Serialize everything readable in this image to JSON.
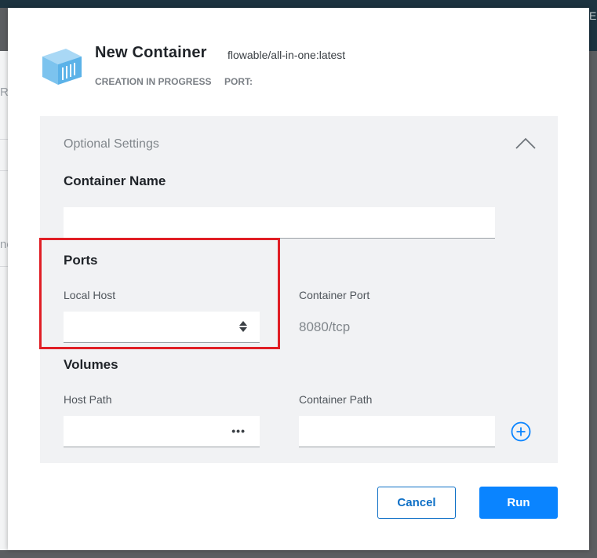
{
  "background": {
    "left_items": [
      "R",
      "ne"
    ],
    "topbar_right_text": "E"
  },
  "header": {
    "title": "New Container",
    "image": "flowable/all-in-one:latest",
    "status": "CREATION IN PROGRESS",
    "port_label": "PORT:",
    "icon": "container-icon"
  },
  "settings": {
    "title": "Optional Settings",
    "toggle_icon": "chevron-up-icon",
    "container_name": {
      "label": "Container Name",
      "value": ""
    },
    "ports": {
      "label": "Ports",
      "local_host_label": "Local Host",
      "local_host_value": "",
      "container_port_label": "Container Port",
      "container_port_value": "8080/tcp"
    },
    "volumes": {
      "label": "Volumes",
      "host_path_label": "Host Path",
      "host_path_value": "",
      "browse_label": "•••",
      "container_path_label": "Container Path",
      "container_path_value": "",
      "add_icon": "plus-circle-icon"
    }
  },
  "actions": {
    "cancel": "Cancel",
    "run": "Run"
  },
  "colors": {
    "accent": "#0a84ff",
    "cancel_border": "#0d6fc6",
    "highlight": "#e01e25",
    "panel_bg": "#f1f2f4"
  }
}
